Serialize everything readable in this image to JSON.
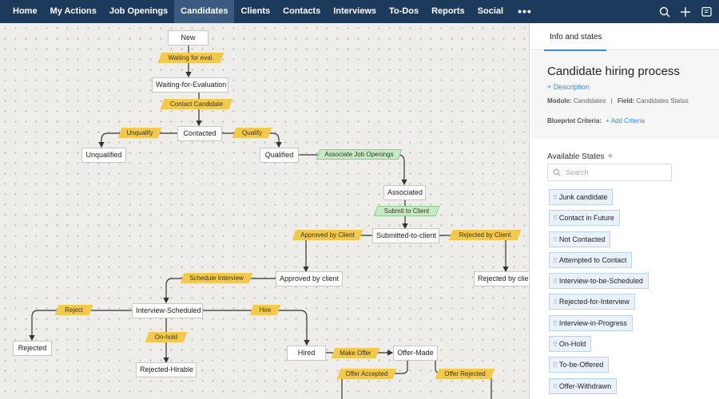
{
  "nav": {
    "items": [
      "Home",
      "My Actions",
      "Job Openings",
      "Candidates",
      "Clients",
      "Contacts",
      "Interviews",
      "To-Dos",
      "Reports",
      "Social"
    ],
    "active": "Candidates",
    "more": "•••",
    "icons": [
      "search-icon",
      "plus-icon",
      "calendar-icon"
    ]
  },
  "flow": {
    "states": {
      "new": "New",
      "waiting": "Waiting-for-Evaluation",
      "contacted": "Contacted",
      "unqualified": "Unqualified",
      "qualified": "Qualified",
      "associated": "Associated",
      "submitted": "Submitted-to-client",
      "approved": "Approved by client",
      "rejected_client": "Rejected by clie",
      "interview_scheduled": "Interview-Scheduled",
      "rejected": "Rejected",
      "rejected_hirable": "Rejected-Hirable",
      "hired": "Hired",
      "offer_made": "Offer-Made"
    },
    "transitions": {
      "waiting_eval": "Waiting for eval.",
      "contact_candidate": "Contact Candidate",
      "unqualify": "Unqualify",
      "qualify": "Qualify",
      "associate_jobs": "Associate Job Openings",
      "submit_client": "Submit to Client",
      "approved_client": "Approved by Client",
      "rejected_client": "Rejected by Client",
      "schedule_interview": "Schedule Interview",
      "reject": "Reject",
      "hire": "Hire",
      "on_hold": "On-hold",
      "make_offer": "Make Offer",
      "offer_accepted": "Offer Accepted",
      "offer_rejected": "Offer Rejected"
    }
  },
  "panel": {
    "tab": "Info and states",
    "title": "Candidate hiring process",
    "description_link": "+ Description",
    "module_label": "Module:",
    "module_value": "Candidates",
    "field_label": "Field:",
    "field_value": "Candidates Status",
    "criteria_label": "Blueprint Criteria:",
    "criteria_link": "+ Add Criteria",
    "available_states": "Available States",
    "add_state": "+",
    "search_placeholder": "Search",
    "states": [
      "Junk candidate",
      "Contact in Future",
      "Not Contacted",
      "Attempted to Contact",
      "Interview-to-be-Scheduled",
      "Rejected-for-Interview",
      "Interview-in-Progress",
      "On-Hold",
      "To-be-Offered",
      "Offer-Withdrawn"
    ]
  },
  "colors": {
    "nav_bg": "#1d3a5c",
    "transition": "#f2c94c",
    "transition_green": "#c5ebc5",
    "accent": "#2f8be6",
    "chip_bg": "#e9f2fb"
  }
}
